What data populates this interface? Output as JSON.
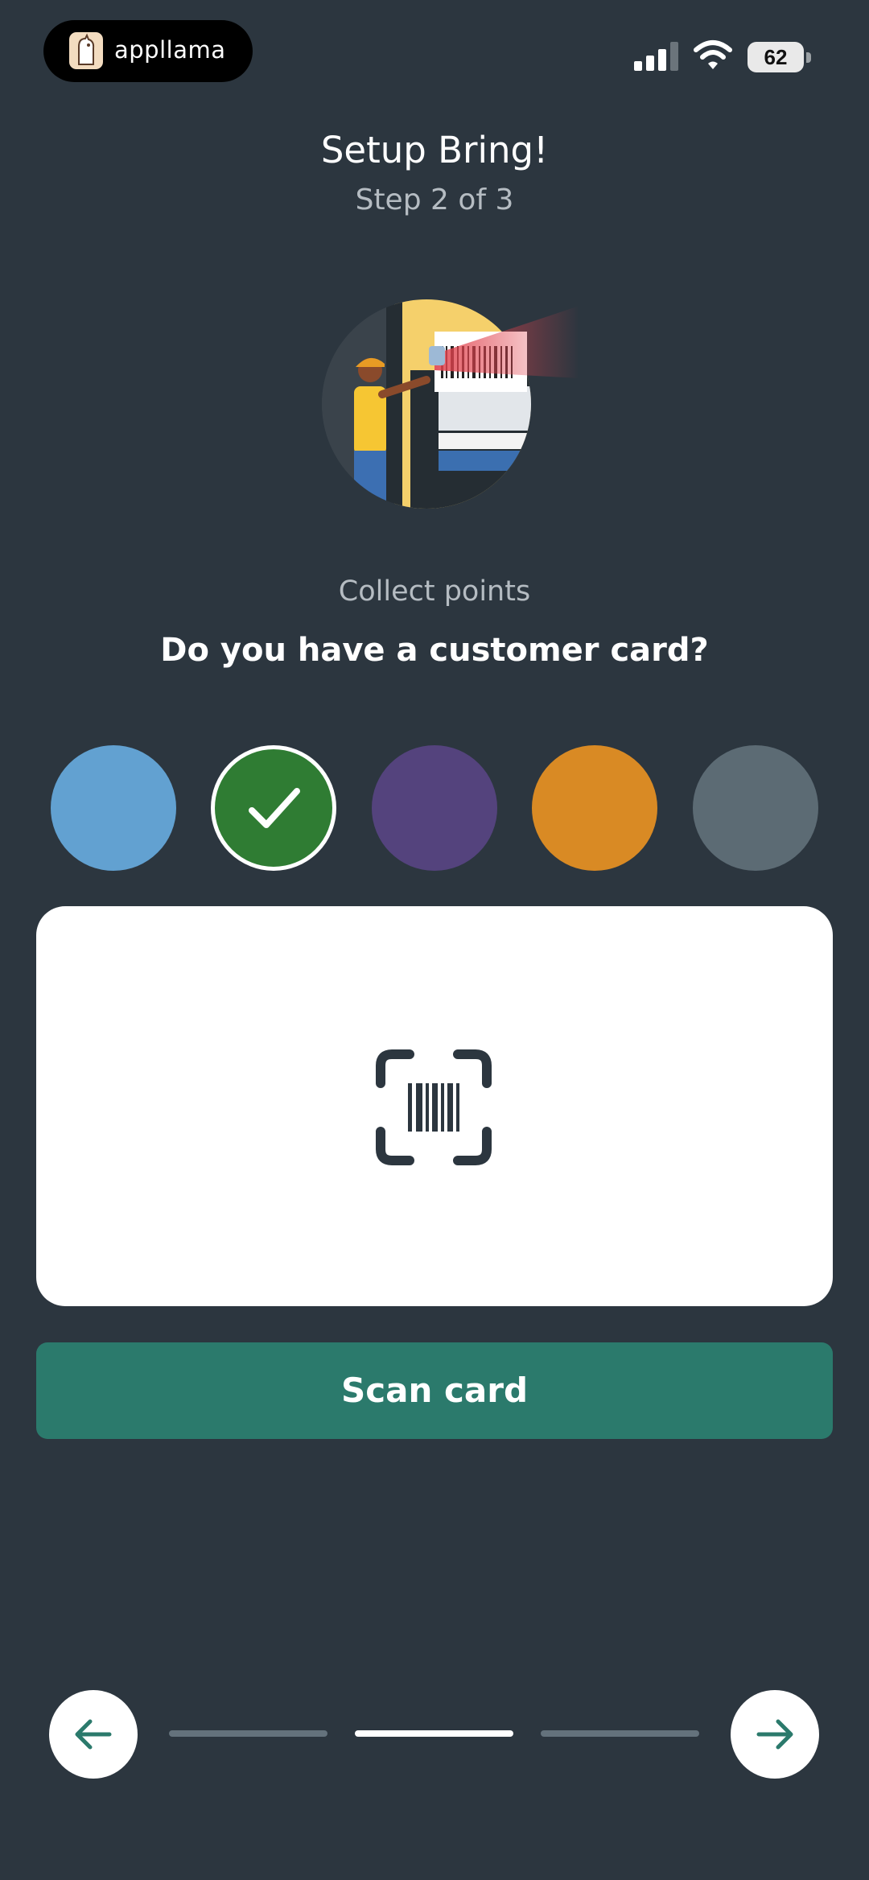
{
  "status_bar": {
    "brand_name": "appllama",
    "battery_level": "62"
  },
  "header": {
    "title": "Setup Bring!",
    "step": "Step 2 of 3"
  },
  "section": {
    "label": "Collect points",
    "question": "Do you have a customer card?"
  },
  "color_options": [
    {
      "color": "#62a1d1",
      "selected": false
    },
    {
      "color": "#2f7c33",
      "selected": true
    },
    {
      "color": "#54437d",
      "selected": false
    },
    {
      "color": "#d98a24",
      "selected": false
    },
    {
      "color": "#5c6b74",
      "selected": false
    }
  ],
  "card_preview": {
    "icon": "barcode-scan-icon"
  },
  "actions": {
    "scan_label": "Scan card"
  },
  "navigation": {
    "back_icon": "arrow-left-icon",
    "next_icon": "arrow-right-icon",
    "steps_total": 3,
    "current_step": 2
  },
  "colors": {
    "background": "#2c363f",
    "accent": "#2b7a6c",
    "card": "#ffffff"
  }
}
